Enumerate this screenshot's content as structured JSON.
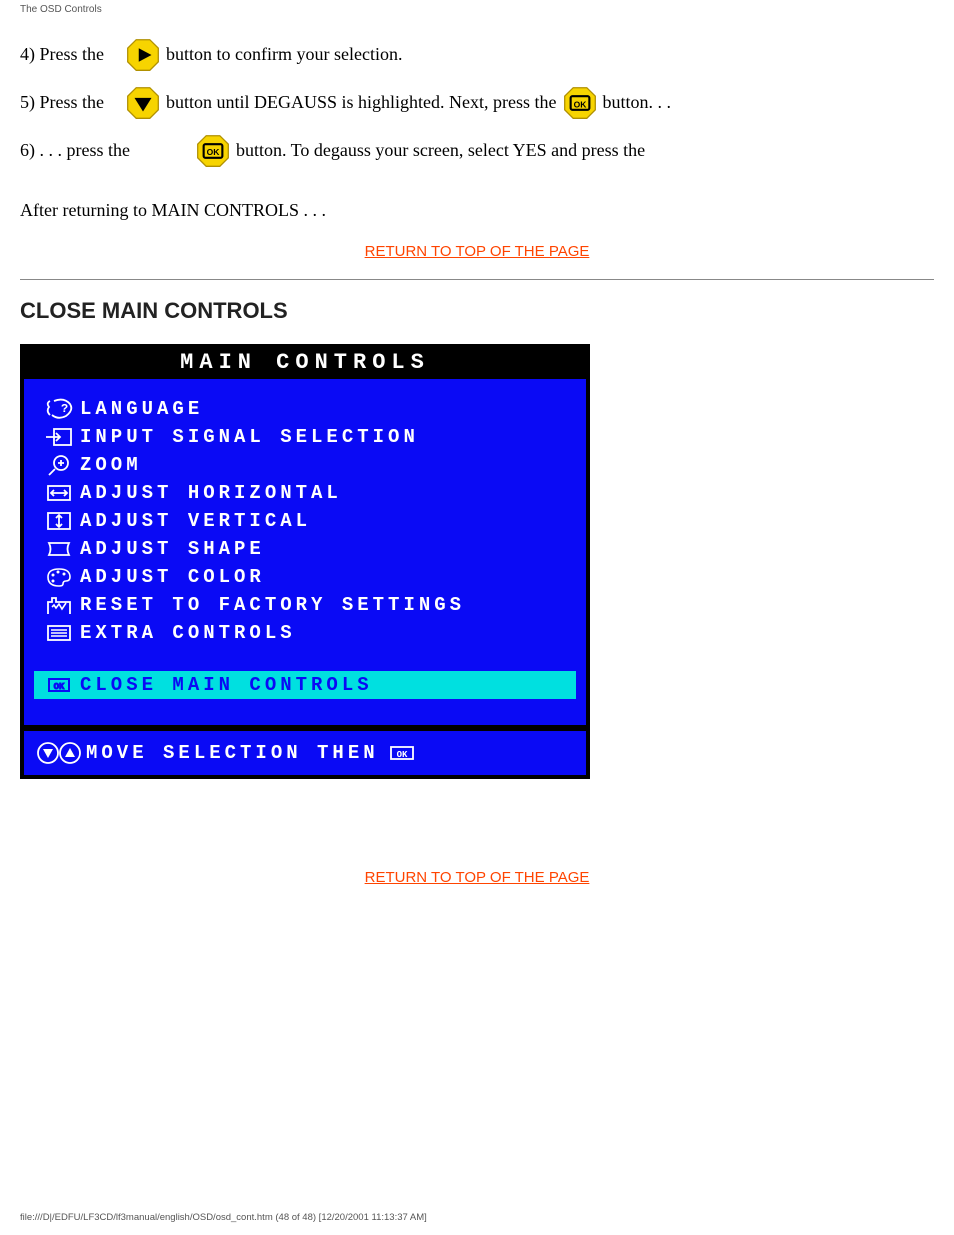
{
  "header_label": "The OSD Controls",
  "steps": {
    "s1_prefix": "4) Press the ",
    "s1_suffix": " button to confirm your selection.",
    "s2_prefix": "5) Press the ",
    "s2_mid": " button until DEGAUSS is highlighted. Next, press the ",
    "s2_suffix": " button. . .",
    "s3_prefix": "6) . . . press the ",
    "s3_suffix": " button. To degauss your screen, select YES and press the"
  },
  "after_steps": "After returning to MAIN CONTROLS . . .",
  "return1": "RETURN TO TOP OF THE PAGE",
  "close_heading": "CLOSE MAIN CONTROLS",
  "osd": {
    "title": "MAIN CONTROLS",
    "items": [
      {
        "icon": "language",
        "label": "LANGUAGE"
      },
      {
        "icon": "input",
        "label": "INPUT SIGNAL SELECTION"
      },
      {
        "icon": "zoom",
        "label": "ZOOM"
      },
      {
        "icon": "horiz",
        "label": "ADJUST HORIZONTAL"
      },
      {
        "icon": "vert",
        "label": "ADJUST VERTICAL"
      },
      {
        "icon": "shape",
        "label": "ADJUST SHAPE"
      },
      {
        "icon": "color",
        "label": "ADJUST COLOR"
      },
      {
        "icon": "reset",
        "label": "RESET TO FACTORY SETTINGS"
      },
      {
        "icon": "extra",
        "label": "EXTRA CONTROLS"
      }
    ],
    "highlight": {
      "icon": "ok",
      "label": "CLOSE MAIN CONTROLS"
    },
    "footer": "MOVE SELECTION THEN",
    "footer_tail_icon": "ok"
  },
  "return2": "RETURN TO TOP OF THE PAGE",
  "footer_path": "file:///D|/EDFU/LF3CD/lf3manual/english/OSD/osd_cont.htm (48 of 48) [12/20/2001 11:13:37 AM]"
}
